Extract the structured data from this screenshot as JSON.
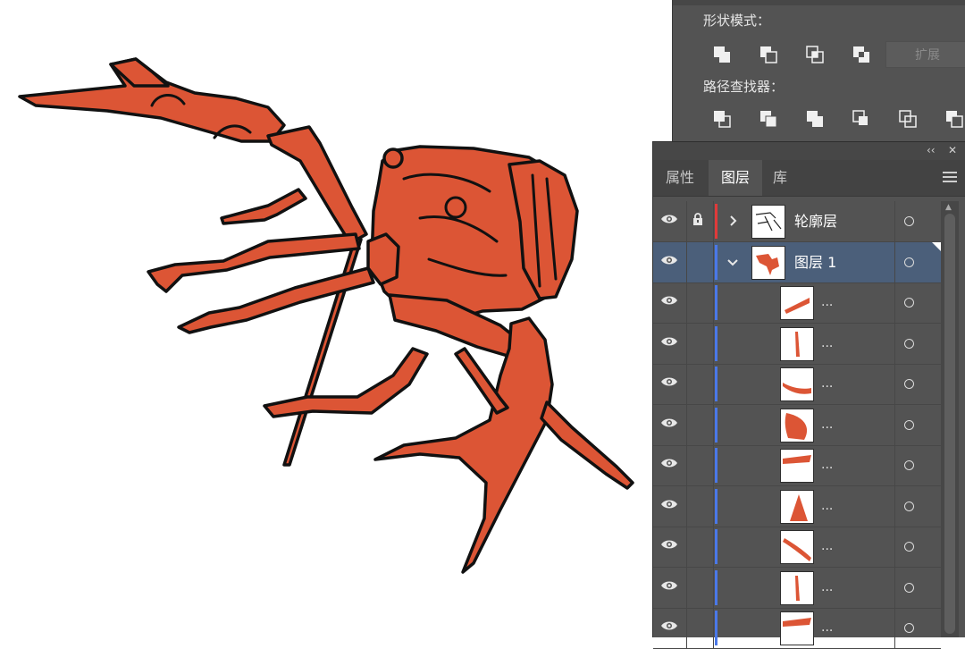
{
  "canvas": {
    "subject": "crayfish-illustration",
    "fill_color": "#dc5535",
    "outline_color": "#111111"
  },
  "pathfinder": {
    "shape_modes_label": "形状模式：",
    "expand_label": "扩展",
    "pathfinders_label": "路径查找器："
  },
  "layers_panel": {
    "collapse_glyph": "‹‹",
    "close_glyph": "✕",
    "tabs": [
      {
        "label": "属性",
        "active": false
      },
      {
        "label": "图层",
        "active": true
      },
      {
        "label": "库",
        "active": false
      }
    ],
    "rows": [
      {
        "name": "轮廓层",
        "color": "#e03a3a",
        "locked": true,
        "expanded": false,
        "selected": false,
        "indent": 0
      },
      {
        "name": "图层 1",
        "color": "#4a78e8",
        "locked": false,
        "expanded": true,
        "selected": true,
        "indent": 0
      },
      {
        "name": "...",
        "color": "#4a78e8",
        "locked": false,
        "indent": 1,
        "thumb": "slash"
      },
      {
        "name": "...",
        "color": "#4a78e8",
        "locked": false,
        "indent": 1,
        "thumb": "vertical"
      },
      {
        "name": "...",
        "color": "#4a78e8",
        "locked": false,
        "indent": 1,
        "thumb": "curve"
      },
      {
        "name": "...",
        "color": "#4a78e8",
        "locked": false,
        "indent": 1,
        "thumb": "leaf"
      },
      {
        "name": "...",
        "color": "#4a78e8",
        "locked": false,
        "indent": 1,
        "thumb": "band"
      },
      {
        "name": "...",
        "color": "#4a78e8",
        "locked": false,
        "indent": 1,
        "thumb": "triangle"
      },
      {
        "name": "...",
        "color": "#4a78e8",
        "locked": false,
        "indent": 1,
        "thumb": "arc"
      },
      {
        "name": "...",
        "color": "#4a78e8",
        "locked": false,
        "indent": 1,
        "thumb": "vertical"
      },
      {
        "name": "...",
        "color": "#4a78e8",
        "locked": false,
        "indent": 1,
        "thumb": "band"
      }
    ]
  }
}
